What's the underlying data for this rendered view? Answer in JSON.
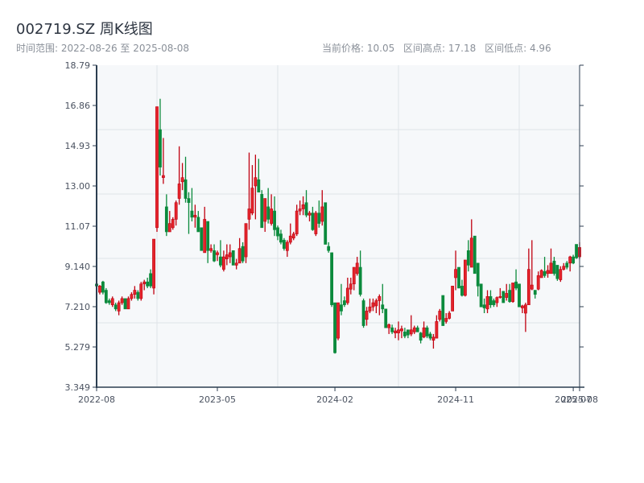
{
  "header": {
    "title": "002719.SZ 周K线图",
    "range_label": "时间范围: 2022-08-26 至 2025-08-08",
    "current_price": "当前价格: 10.05",
    "range_high": "区间高点: 17.18",
    "range_low": "区间低点: 4.96"
  },
  "chart_data": {
    "type": "candlestick",
    "title": "002719.SZ 周K线图",
    "frequency": "weekly",
    "start_date": "2022-08-26",
    "end_date": "2025-08-08",
    "ylim": [
      3.349,
      18.79
    ],
    "y_ticks": [
      "3.349",
      "5.279",
      "7.210",
      "9.140",
      "11.07",
      "13.00",
      "14.93",
      "16.86",
      "18.79"
    ],
    "x_ticks": [
      {
        "label": "2022-08",
        "index": 0
      },
      {
        "label": "2023-05",
        "index": 38
      },
      {
        "label": "2024-02",
        "index": 75
      },
      {
        "label": "2024-11",
        "index": 113
      },
      {
        "label": "2025-07",
        "index": 150
      },
      {
        "label": "2025-08",
        "index": 152
      }
    ],
    "grid": true,
    "colors": {
      "up": "#e3242b",
      "up_border": "#c00010",
      "down": "#0b8a3c",
      "background": "#f6f8fa",
      "axis": "#2c3e50",
      "grid": "#dfe3e8"
    },
    "ohlc_order": [
      "open",
      "close",
      "low",
      "high"
    ],
    "candles": [
      [
        8.3,
        8.2,
        8.1,
        8.35
      ],
      [
        7.9,
        8.2,
        7.8,
        8.25
      ],
      [
        8.4,
        7.9,
        7.8,
        8.45
      ],
      [
        8.0,
        7.4,
        7.35,
        8.1
      ],
      [
        7.5,
        7.4,
        7.3,
        7.6
      ],
      [
        7.3,
        7.6,
        7.2,
        7.7
      ],
      [
        7.3,
        7.1,
        7.0,
        7.4
      ],
      [
        7.0,
        7.4,
        6.8,
        7.5
      ],
      [
        7.4,
        7.6,
        7.3,
        7.7
      ],
      [
        7.6,
        7.1,
        7.1,
        7.6
      ],
      [
        7.1,
        7.6,
        7.1,
        7.7
      ],
      [
        7.6,
        7.8,
        7.5,
        7.9
      ],
      [
        7.8,
        8.0,
        7.6,
        8.2
      ],
      [
        7.9,
        7.6,
        7.5,
        8.0
      ],
      [
        7.6,
        8.3,
        7.5,
        8.4
      ],
      [
        8.3,
        8.4,
        8.0,
        8.5
      ],
      [
        8.4,
        8.2,
        8.1,
        8.6
      ],
      [
        8.8,
        8.2,
        8.1,
        9.0
      ],
      [
        8.1,
        10.45,
        7.8,
        10.45
      ],
      [
        11.0,
        16.8,
        10.8,
        16.8
      ],
      [
        15.7,
        13.9,
        13.5,
        17.18
      ],
      [
        13.4,
        13.5,
        13.1,
        15.3
      ],
      [
        12.0,
        10.8,
        10.6,
        12.6
      ],
      [
        10.8,
        11.2,
        10.8,
        11.8
      ],
      [
        11.0,
        11.4,
        10.9,
        11.5
      ],
      [
        11.4,
        12.2,
        11.1,
        12.3
      ],
      [
        12.4,
        13.1,
        12.1,
        14.9
      ],
      [
        13.2,
        13.4,
        12.8,
        14.1
      ],
      [
        13.3,
        12.4,
        12.2,
        14.4
      ],
      [
        12.4,
        12.2,
        10.7,
        12.7
      ],
      [
        11.8,
        11.5,
        11.3,
        12.9
      ],
      [
        11.5,
        11.6,
        11.0,
        12.1
      ],
      [
        11.5,
        10.8,
        10.8,
        11.8
      ],
      [
        11.0,
        9.9,
        9.9,
        11.0
      ],
      [
        9.8,
        11.4,
        9.8,
        12.0
      ],
      [
        11.3,
        9.9,
        9.3,
        11.3
      ],
      [
        9.9,
        10.0,
        9.8,
        10.2
      ],
      [
        9.9,
        9.4,
        9.35,
        10.2
      ],
      [
        9.7,
        9.8,
        9.4,
        9.9
      ],
      [
        9.6,
        9.2,
        9.1,
        10.4
      ],
      [
        9.0,
        9.6,
        8.9,
        9.9
      ],
      [
        9.5,
        9.7,
        9.2,
        10.2
      ],
      [
        9.6,
        9.8,
        9.3,
        10.2
      ],
      [
        9.9,
        9.2,
        9.2,
        9.9
      ],
      [
        9.2,
        9.3,
        9.0,
        9.5
      ],
      [
        9.3,
        10.0,
        9.3,
        10.5
      ],
      [
        10.1,
        9.4,
        9.3,
        10.3
      ],
      [
        9.6,
        11.2,
        9.3,
        11.2
      ],
      [
        11.4,
        11.9,
        10.9,
        14.6
      ],
      [
        11.7,
        12.9,
        11.6,
        14.0
      ],
      [
        13.0,
        13.4,
        11.4,
        14.5
      ],
      [
        13.3,
        12.7,
        12.7,
        14.3
      ],
      [
        12.6,
        11.0,
        11.0,
        12.8
      ],
      [
        11.3,
        12.4,
        10.8,
        12.4
      ],
      [
        12.0,
        11.4,
        11.2,
        12.9
      ],
      [
        11.2,
        11.9,
        11.1,
        12.6
      ],
      [
        11.8,
        10.9,
        10.6,
        12.5
      ],
      [
        11.0,
        10.6,
        10.4,
        11.1
      ],
      [
        10.7,
        10.3,
        10.2,
        10.9
      ],
      [
        10.4,
        10.0,
        9.9,
        10.5
      ],
      [
        9.9,
        10.3,
        9.6,
        10.4
      ],
      [
        10.3,
        10.6,
        10.2,
        11.2
      ],
      [
        10.5,
        10.7,
        10.4,
        10.8
      ],
      [
        10.7,
        11.8,
        10.6,
        12.1
      ],
      [
        11.8,
        11.9,
        11.6,
        12.3
      ],
      [
        11.9,
        12.1,
        11.6,
        12.5
      ],
      [
        12.2,
        11.6,
        11.5,
        12.8
      ],
      [
        11.6,
        11.7,
        11.3,
        11.8
      ],
      [
        11.7,
        10.9,
        10.85,
        12.0
      ],
      [
        10.7,
        11.7,
        10.6,
        11.8
      ],
      [
        11.7,
        11.2,
        11.0,
        12.3
      ],
      [
        11.3,
        12.0,
        11.1,
        12.8
      ],
      [
        12.2,
        10.2,
        10.2,
        12.2
      ],
      [
        10.1,
        9.9,
        9.8,
        10.3
      ],
      [
        9.8,
        7.3,
        7.2,
        9.8
      ],
      [
        7.4,
        5.0,
        4.96,
        7.4
      ],
      [
        5.7,
        7.4,
        5.6,
        7.4
      ],
      [
        7.3,
        7.0,
        6.8,
        8.3
      ],
      [
        7.5,
        7.3,
        7.2,
        7.7
      ],
      [
        7.4,
        8.1,
        7.3,
        8.6
      ],
      [
        8.05,
        8.3,
        7.8,
        8.6
      ],
      [
        8.3,
        9.1,
        8.0,
        9.1
      ],
      [
        8.8,
        9.3,
        8.7,
        9.6
      ],
      [
        9.1,
        7.8,
        7.7,
        9.9
      ],
      [
        7.5,
        6.3,
        6.2,
        7.6
      ],
      [
        6.6,
        7.0,
        6.3,
        7.2
      ],
      [
        7.0,
        7.2,
        6.9,
        7.6
      ],
      [
        7.2,
        7.4,
        7.0,
        7.6
      ],
      [
        7.25,
        7.5,
        6.9,
        7.6
      ],
      [
        7.5,
        7.7,
        6.8,
        7.8
      ],
      [
        7.3,
        7.1,
        6.9,
        8.3
      ],
      [
        7.1,
        6.2,
        6.2,
        7.1
      ],
      [
        6.2,
        6.35,
        5.9,
        6.4
      ],
      [
        6.2,
        6.0,
        5.9,
        6.35
      ],
      [
        5.95,
        6.05,
        5.7,
        6.2
      ],
      [
        5.95,
        6.1,
        5.6,
        6.5
      ],
      [
        6.05,
        6.15,
        5.7,
        6.3
      ],
      [
        6.0,
        5.8,
        5.7,
        6.2
      ],
      [
        6.1,
        5.85,
        5.7,
        6.1
      ],
      [
        5.9,
        6.1,
        5.8,
        6.8
      ],
      [
        6.0,
        6.2,
        5.9,
        6.3
      ],
      [
        6.2,
        6.0,
        6.0,
        6.3
      ],
      [
        5.95,
        5.6,
        5.45,
        6.0
      ],
      [
        5.75,
        6.2,
        5.7,
        6.5
      ],
      [
        6.2,
        5.8,
        5.7,
        6.3
      ],
      [
        5.9,
        5.7,
        5.6,
        6.0
      ],
      [
        5.6,
        5.75,
        5.2,
        5.9
      ],
      [
        5.7,
        6.5,
        5.7,
        6.8
      ],
      [
        6.6,
        7.0,
        6.5,
        7.1
      ],
      [
        7.75,
        6.3,
        6.3,
        7.75
      ],
      [
        6.5,
        6.65,
        6.4,
        6.9
      ],
      [
        6.65,
        6.9,
        6.6,
        7.0
      ],
      [
        7.0,
        8.2,
        7.0,
        8.2
      ],
      [
        8.6,
        9.0,
        8.0,
        9.9
      ],
      [
        9.1,
        8.1,
        8.1,
        9.1
      ],
      [
        8.2,
        7.75,
        7.7,
        8.5
      ],
      [
        7.75,
        9.45,
        7.7,
        9.45
      ],
      [
        9.9,
        9.2,
        8.9,
        10.4
      ],
      [
        9.1,
        10.5,
        9.1,
        11.4
      ],
      [
        10.6,
        8.8,
        8.8,
        10.6
      ],
      [
        9.3,
        8.2,
        7.7,
        9.3
      ],
      [
        8.3,
        7.2,
        7.2,
        8.3
      ],
      [
        7.3,
        7.15,
        6.9,
        7.6
      ],
      [
        7.1,
        7.7,
        6.9,
        8.0
      ],
      [
        7.7,
        7.3,
        7.15,
        8.0
      ],
      [
        7.5,
        7.3,
        7.2,
        7.6
      ],
      [
        7.4,
        7.65,
        7.2,
        7.7
      ],
      [
        7.65,
        7.7,
        7.6,
        8.1
      ],
      [
        7.95,
        7.4,
        7.4,
        7.95
      ],
      [
        7.65,
        7.85,
        7.5,
        8.3
      ],
      [
        8.0,
        7.45,
        7.4,
        8.3
      ],
      [
        7.45,
        8.35,
        7.4,
        8.35
      ],
      [
        8.4,
        8.1,
        8.0,
        9.0
      ],
      [
        8.3,
        7.2,
        7.2,
        8.3
      ],
      [
        7.15,
        7.25,
        6.9,
        7.3
      ],
      [
        6.9,
        7.3,
        6.0,
        7.4
      ],
      [
        7.3,
        9.0,
        7.3,
        10.0
      ],
      [
        8.05,
        8.25,
        8.0,
        10.4
      ],
      [
        8.0,
        7.8,
        7.6,
        8.0
      ],
      [
        8.05,
        8.7,
        8.0,
        8.9
      ],
      [
        8.6,
        8.95,
        8.6,
        9.0
      ],
      [
        8.9,
        8.7,
        8.6,
        9.6
      ],
      [
        8.8,
        8.95,
        8.6,
        9.2
      ],
      [
        8.8,
        9.3,
        8.8,
        10.0
      ],
      [
        9.4,
        8.8,
        8.7,
        9.6
      ],
      [
        9.2,
        8.55,
        8.45,
        9.2
      ],
      [
        8.5,
        9.0,
        8.4,
        9.15
      ],
      [
        9.0,
        9.15,
        8.95,
        9.3
      ],
      [
        9.3,
        9.1,
        9.0,
        9.4
      ],
      [
        9.3,
        9.6,
        8.9,
        9.65
      ],
      [
        9.6,
        9.3,
        9.25,
        9.7
      ],
      [
        10.2,
        9.55,
        9.5,
        10.2
      ],
      [
        9.6,
        10.05,
        9.5,
        10.3
      ]
    ]
  }
}
